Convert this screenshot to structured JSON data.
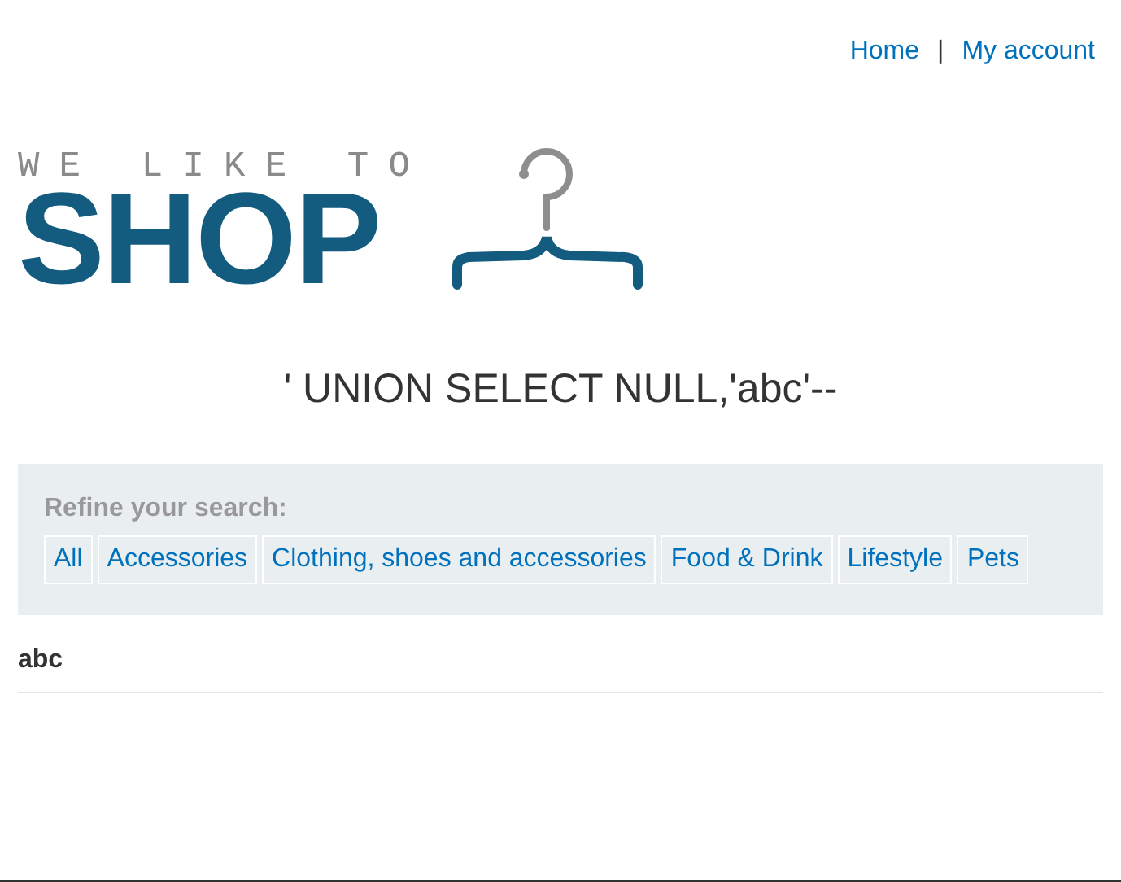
{
  "header": {
    "links": [
      {
        "label": "Home"
      },
      {
        "label": "My account"
      }
    ],
    "separator": "|"
  },
  "logo": {
    "tagline": "WE LIKE TO",
    "name": "SHOP"
  },
  "search_heading": "' UNION SELECT NULL,'abc'--",
  "filters": {
    "label": "Refine your search:",
    "categories": [
      {
        "label": "All"
      },
      {
        "label": "Accessories"
      },
      {
        "label": "Clothing, shoes and accessories"
      },
      {
        "label": "Food & Drink"
      },
      {
        "label": "Lifestyle"
      },
      {
        "label": "Pets"
      }
    ]
  },
  "results": [
    {
      "title": "abc"
    }
  ]
}
